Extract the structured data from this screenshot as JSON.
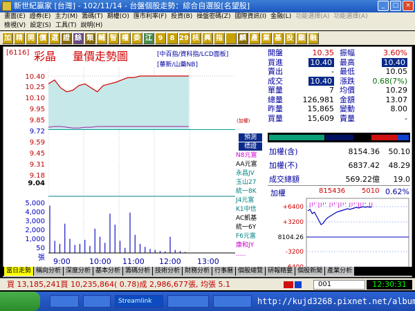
{
  "window": {
    "title": "新世紀贏家 [台灣] - 102/11/14 - 台盤個股走勢：綜合自選股[名望股]"
  },
  "menu": {
    "row1": [
      "畫面(E)",
      "證券(E)",
      "主力(M)",
      "籌碼(T)",
      "期權(O)",
      "匯市利率(F)",
      "投資(B)",
      "操盤密碼(Z)",
      "國際資訊(I)",
      "金融(L)",
      "功能選擇(A)",
      "功能選擇(A)"
    ],
    "row2": [
      "檢視(V)",
      "設定(S)",
      "工具(T)",
      "說明(H)"
    ]
  },
  "toolbar": {
    "buttons": [
      "加",
      "精",
      "開",
      "價",
      "選",
      "證",
      "餘",
      "類",
      "輔",
      "智",
      "權",
      "委",
      "江",
      "9",
      "8",
      "29",
      "核",
      "興",
      "指",
      "",
      "麟",
      "產",
      "業",
      "基",
      "投",
      "顯",
      "融"
    ]
  },
  "stock": {
    "code": "[6116]",
    "name": "彩晶",
    "chart_title": "量價走勢圖",
    "link1": "[中百指/資科指/LCD面板]",
    "link2": "[華新/山藥NB]",
    "tag": "(加權)"
  },
  "quotes": {
    "rows": [
      {
        "k1": "開盤",
        "v1": "10.35",
        "k2": "振幅",
        "v2": "3.60%",
        "c1": "red",
        "c2": "red"
      },
      {
        "k1": "買進",
        "v1": "10.40",
        "k2": "最高",
        "v2": "10.40",
        "c1": "hi",
        "c2": "hi"
      },
      {
        "k1": "賣出",
        "v1": "-",
        "k2": "最低",
        "v2": "10.05",
        "c1": "",
        "c2": ""
      },
      {
        "k1": "成交",
        "v1": "10.40",
        "k2": "漲跌",
        "v2": "0.68(7%)",
        "c1": "hi",
        "c2": "grn"
      },
      {
        "k1": "單量",
        "v1": "7",
        "k2": "均價",
        "v2": "10.29",
        "c1": "",
        "c2": ""
      },
      {
        "k1": "總量",
        "v1": "126,981",
        "k2": "金額",
        "v2": "13.07",
        "c1": "",
        "c2": ""
      },
      {
        "k1": "昨量",
        "v1": "15,865",
        "k2": "變動",
        "v2": "8.00",
        "c1": "",
        "c2": ""
      },
      {
        "k1": "買量",
        "v1": "15,609",
        "k2": "賣量",
        "v2": "-",
        "c1": "",
        "c2": ""
      }
    ]
  },
  "advance": {
    "rows": [
      {
        "k": "加權(含)",
        "v": "8154.36",
        "p": "50.10"
      },
      {
        "k": "加權(不)",
        "v": "6837.42",
        "p": "48.29"
      },
      {
        "k": "成交總額",
        "v": "569.22億",
        "p": "19.0"
      }
    ]
  },
  "mini": {
    "title": "加權",
    "value": "815436",
    "change": "5010",
    "pct": "0.62%",
    "yticks": [
      "+6400",
      "+3200",
      "8104.26",
      "-3200",
      "-6400"
    ],
    "center": "8104.26"
  },
  "legend": {
    "btn1": "預測",
    "btn2": "標證",
    "items": [
      "N8元富",
      "AA元富",
      "永昌JV",
      "玉山27",
      "統一8K",
      "J4元富",
      "K1中信",
      "AC凱基",
      "統一6Y",
      "F6元富",
      "康和JY"
    ],
    "dots": "....."
  },
  "chart_data": {
    "type": "line",
    "x": [
      "9:00",
      "10:00",
      "11:00",
      "12:00",
      "13:00"
    ],
    "price_ticks": [
      "10.40",
      "10.25",
      "10.10",
      "9.95",
      "9.85",
      "9.72",
      "9.59",
      "9.45",
      "9.31",
      "9.18",
      "9.04"
    ],
    "volume_ticks": [
      "5,000",
      "4,000",
      "3,000",
      "2,000",
      "1,000",
      "50"
    ],
    "ref_price": "9.72",
    "volume_unit": "張",
    "price": [
      10.3,
      10.35,
      10.25,
      10.2,
      10.22,
      10.28,
      10.3,
      10.25,
      10.2,
      10.28,
      10.3,
      10.32,
      10.35,
      10.38,
      10.38,
      10.4,
      10.4,
      10.4,
      10.4,
      10.4,
      10.4,
      10.4,
      10.4,
      10.4
    ],
    "avg": [
      9.75,
      9.76,
      9.76,
      9.75,
      9.74,
      9.74,
      9.75,
      9.75,
      9.76,
      9.76,
      9.76,
      9.76,
      9.76,
      9.76,
      9.76,
      9.76,
      9.76,
      9.76,
      9.76,
      9.76,
      9.76,
      9.76,
      9.76,
      9.76
    ],
    "volume": [
      4700,
      1200,
      900,
      2900,
      1400,
      800,
      900,
      1300,
      700,
      2400,
      1600,
      1000,
      3900,
      2800,
      1200,
      500,
      4000,
      1800,
      900,
      600,
      400,
      300,
      200,
      150,
      1600,
      300,
      200,
      100
    ]
  },
  "tabs": [
    "當日走勢",
    "稱向分析",
    "深度分析",
    "基本分析",
    "籌碼分析",
    "技術分析",
    "財務分析",
    "行事曆",
    "個股總覽",
    "研報精要",
    "個股新聞",
    "產業分析"
  ],
  "status": {
    "text": "買 13,185,241買 10,235,864( 0.78)成 2,986,677張, 均張 5.1",
    "box": "001",
    "clock": "12:30:31"
  },
  "taskbar": {
    "items": [
      "",
      "",
      "Streamlink",
      "",
      "",
      ""
    ]
  },
  "watermark": "http://kujd3268.pixnet.net/album"
}
